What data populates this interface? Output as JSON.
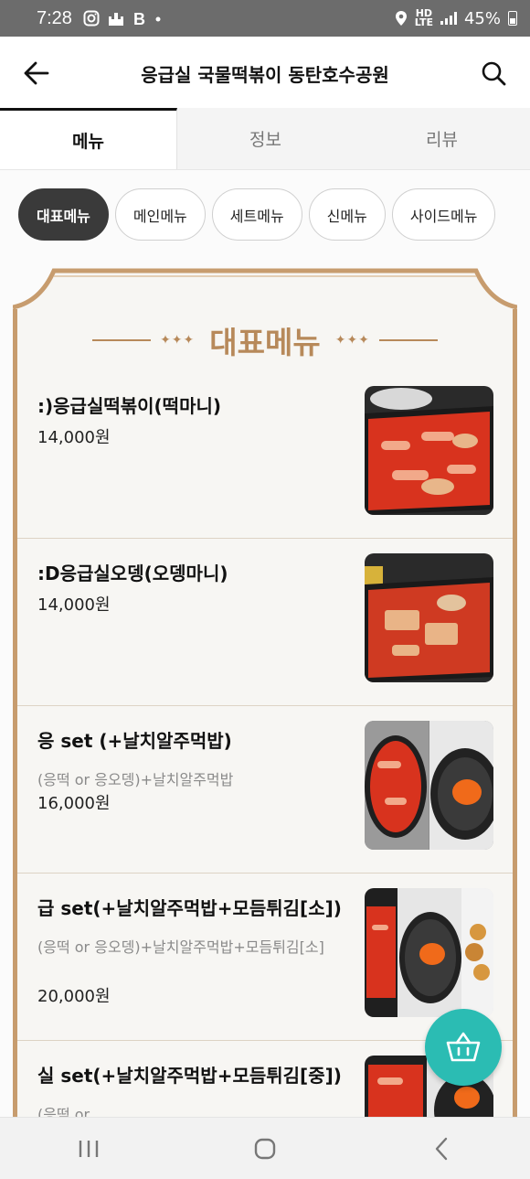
{
  "status_bar": {
    "time": "7:28",
    "left_icons": [
      "instagram-icon",
      "castle-icon",
      "b-icon",
      "dot-icon"
    ],
    "hd_top": "HD",
    "hd_bottom": "LTE",
    "battery": "45%"
  },
  "header": {
    "title": "응급실 국물떡볶이 동탄호수공원",
    "back_icon": "back-arrow-icon",
    "search_icon": "search-icon"
  },
  "tabs": [
    {
      "label": "메뉴",
      "active": true
    },
    {
      "label": "정보",
      "active": false
    },
    {
      "label": "리뷰",
      "active": false
    }
  ],
  "categories": [
    {
      "label": "대표메뉴",
      "active": true
    },
    {
      "label": "메인메뉴",
      "active": false
    },
    {
      "label": "세트메뉴",
      "active": false
    },
    {
      "label": "신메뉴",
      "active": false
    },
    {
      "label": "사이드메뉴",
      "active": false
    }
  ],
  "section": {
    "title": "대표메뉴",
    "ornament_left": "✦✦✦",
    "ornament_right": "✦✦✦"
  },
  "menu_items": [
    {
      "name": ":)응급실떡볶이(떡마니)",
      "desc": "",
      "price": "14,000원"
    },
    {
      "name": ":D응급실오뎅(오뎅마니)",
      "desc": "",
      "price": "14,000원"
    },
    {
      "name": "응 set (+날치알주먹밥)",
      "desc": "(응떡 or 응오뎅)+날치알주먹밥",
      "price": "16,000원"
    },
    {
      "name": "급 set(+날치알주먹밥+모듬튀김[소])",
      "desc": "(응떡 or 응오뎅)+날치알주먹밥+모듬튀김[소]",
      "price": "20,000원"
    },
    {
      "name": "실 set(+날치알주먹밥+모듬튀김[중])",
      "desc": "(응떡 or",
      "price": ""
    }
  ],
  "colors": {
    "accent_gold": "#b7895a",
    "cart_teal": "#2bbcb3",
    "chip_active": "#3a3a3a",
    "status_bar": "#6c6c6c"
  },
  "fab_icon": "shopping-basket-icon",
  "nav_icons": [
    "recent-apps-icon",
    "home-icon",
    "back-icon"
  ]
}
